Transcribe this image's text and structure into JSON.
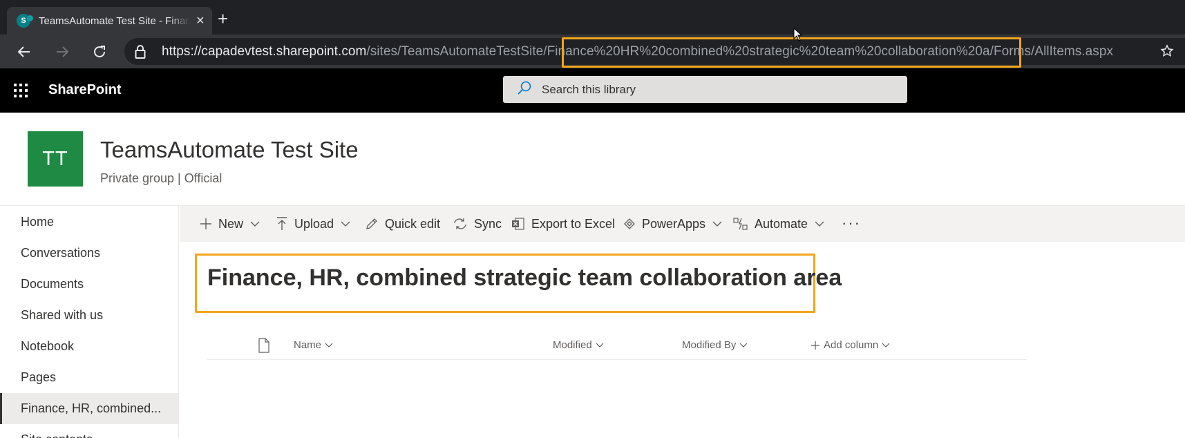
{
  "browser": {
    "tab_title": "TeamsAutomate Test Site - Finance",
    "favicon_letter": "S",
    "url_host": "https://capadevtest.sharepoint.com",
    "url_path_before": "/sites/TeamsAutomateTestSite",
    "url_path_highlight": "/Finance%20HR%20combined%20strategic%20team%20collaboration%20a",
    "url_path_after": "/Forms/AllItems.aspx",
    "highlight_color": "#f2a51a"
  },
  "suitebar": {
    "brand": "SharePoint",
    "search_placeholder": "Search this library"
  },
  "site": {
    "logo_initials": "TT",
    "logo_color": "#1e8a43",
    "title": "TeamsAutomate Test Site",
    "subtitle": "Private group | Official"
  },
  "leftnav": {
    "items": [
      {
        "label": "Home",
        "selected": false
      },
      {
        "label": "Conversations",
        "selected": false
      },
      {
        "label": "Documents",
        "selected": false
      },
      {
        "label": "Shared with us",
        "selected": false
      },
      {
        "label": "Notebook",
        "selected": false
      },
      {
        "label": "Pages",
        "selected": false
      },
      {
        "label": "Finance, HR, combined...",
        "selected": true
      },
      {
        "label": "Site contents",
        "selected": false
      }
    ]
  },
  "commandbar": {
    "new": "New",
    "upload": "Upload",
    "quick_edit": "Quick edit",
    "sync": "Sync",
    "export": "Export to Excel",
    "powerapps": "PowerApps",
    "automate": "Automate",
    "more": "···"
  },
  "library": {
    "title": "Finance, HR, combined strategic team collaboration area",
    "columns": {
      "name": "Name",
      "modified": "Modified",
      "modified_by": "Modified By",
      "add_column": "Add column"
    }
  }
}
